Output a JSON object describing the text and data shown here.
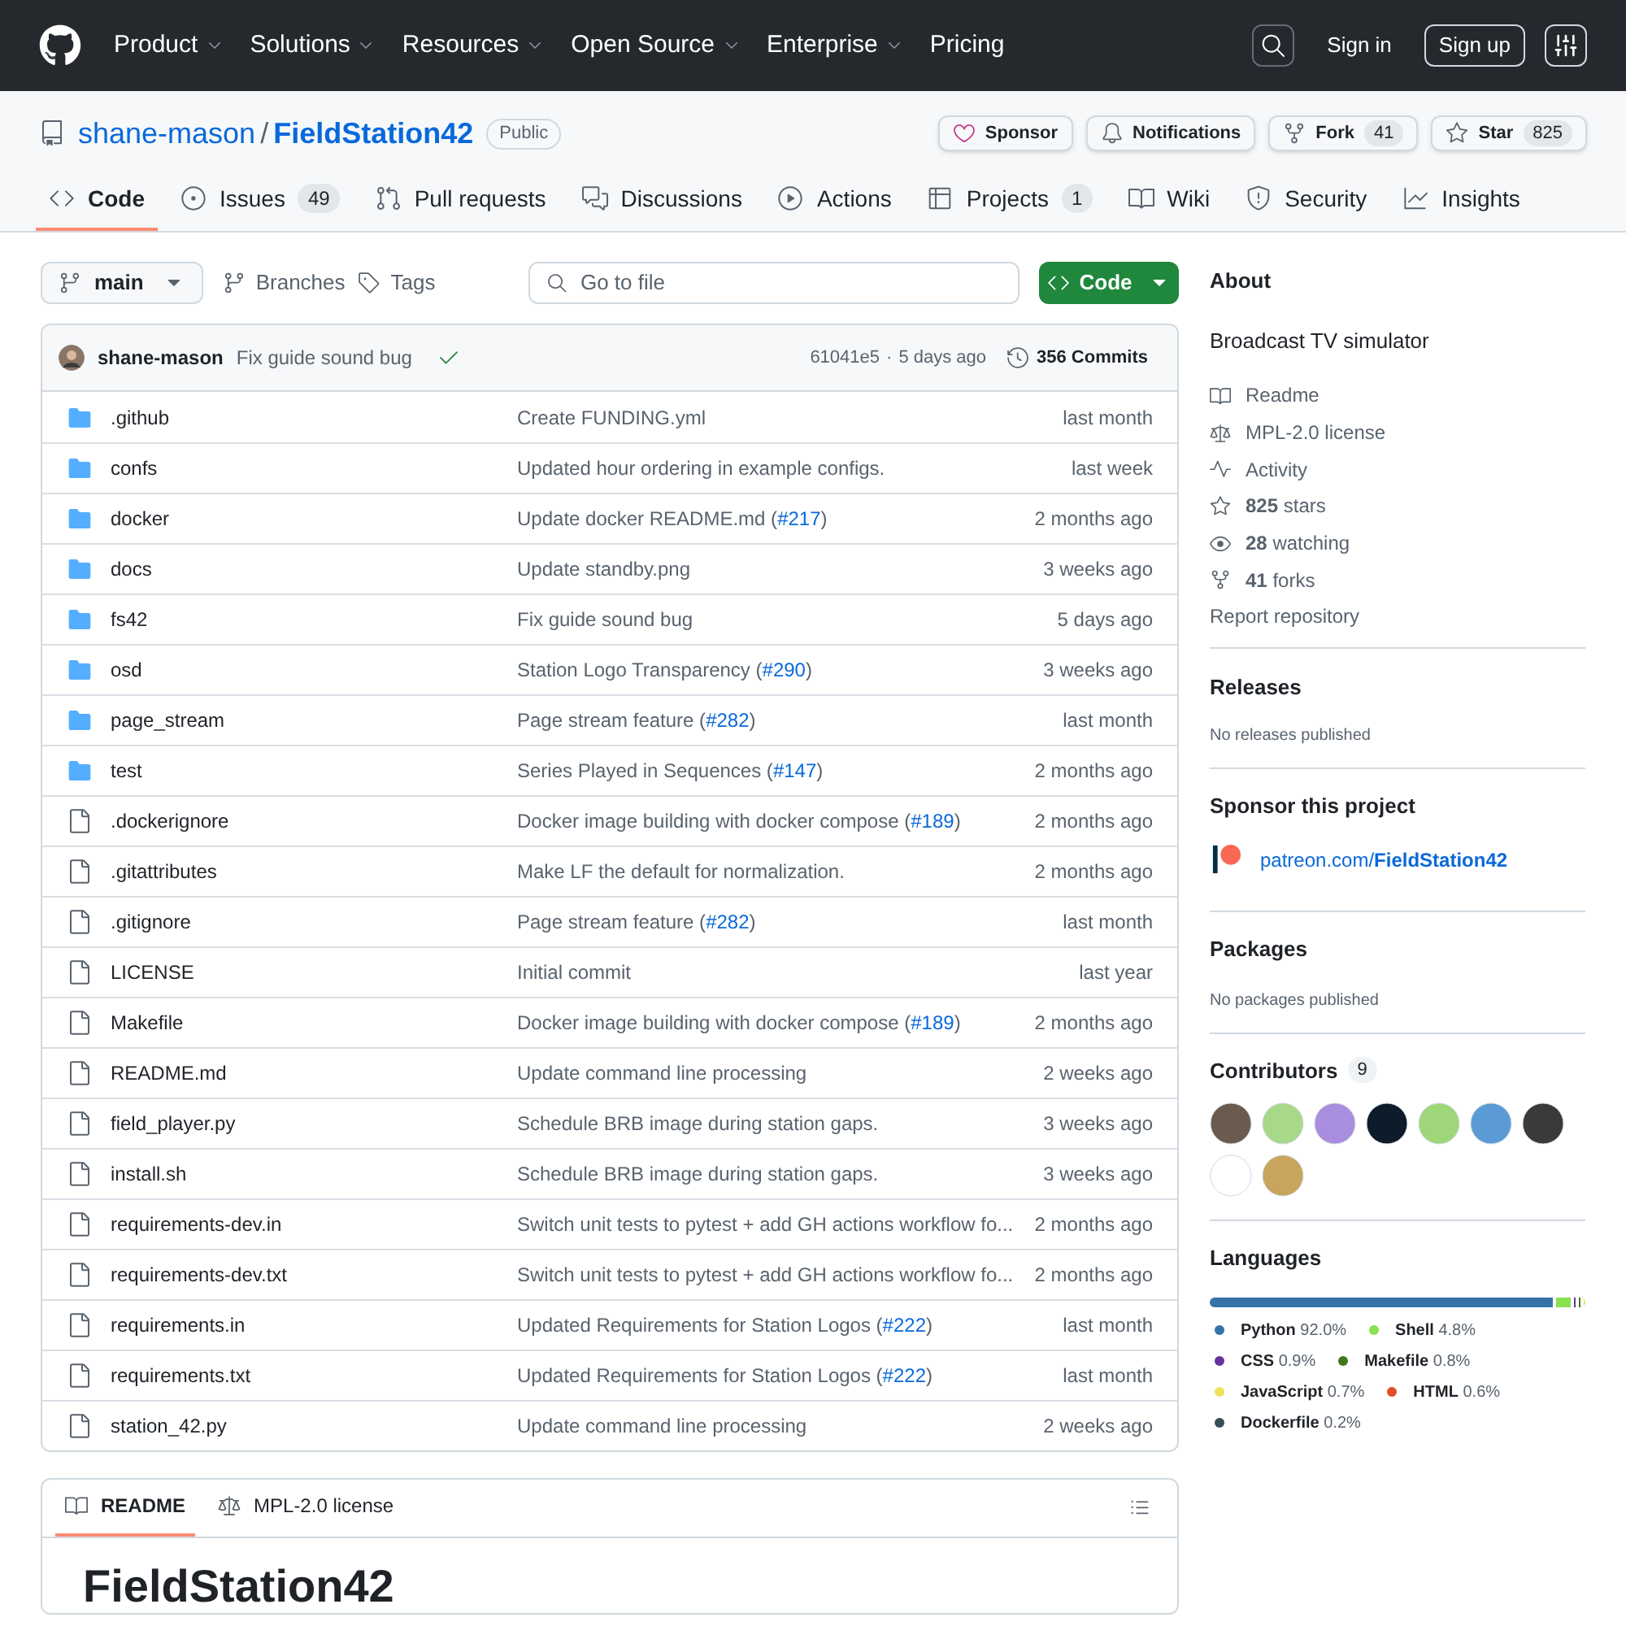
{
  "top_nav": {
    "items": [
      {
        "label": "Product",
        "dropdown": true
      },
      {
        "label": "Solutions",
        "dropdown": true
      },
      {
        "label": "Resources",
        "dropdown": true
      },
      {
        "label": "Open Source",
        "dropdown": true
      },
      {
        "label": "Enterprise",
        "dropdown": true
      },
      {
        "label": "Pricing",
        "dropdown": false
      }
    ],
    "sign_in": "Sign in",
    "sign_up": "Sign up"
  },
  "repo": {
    "owner": "shane-mason",
    "separator": "/",
    "name": "FieldStation42",
    "visibility": "Public",
    "actions": [
      {
        "kind": "sponsor",
        "label": "Sponsor"
      },
      {
        "kind": "notifications",
        "label": "Notifications"
      },
      {
        "kind": "fork",
        "label": "Fork",
        "count": "41"
      },
      {
        "kind": "star",
        "label": "Star",
        "count": "825"
      }
    ]
  },
  "tabs": [
    {
      "kind": "code",
      "label": "Code",
      "selected": true
    },
    {
      "kind": "issues",
      "label": "Issues",
      "count": "49",
      "selected": false
    },
    {
      "kind": "pulls",
      "label": "Pull requests",
      "selected": false
    },
    {
      "kind": "discussions",
      "label": "Discussions",
      "selected": false
    },
    {
      "kind": "actions",
      "label": "Actions",
      "selected": false
    },
    {
      "kind": "projects",
      "label": "Projects",
      "count": "1",
      "selected": false
    },
    {
      "kind": "wiki",
      "label": "Wiki",
      "selected": false
    },
    {
      "kind": "security",
      "label": "Security",
      "selected": false
    },
    {
      "kind": "insights",
      "label": "Insights",
      "selected": false
    }
  ],
  "toolbar": {
    "branch": "main",
    "branches": "Branches",
    "tags": "Tags",
    "search": {
      "placeholder": "Go to file"
    },
    "code_button": "Code"
  },
  "latest_commit": {
    "author": "shane-mason",
    "message": "Fix guide sound bug",
    "status_ok": true,
    "sha": "61041e5",
    "separator": "·",
    "time": "5 days ago",
    "commits": "356 Commits"
  },
  "files": [
    {
      "kind": "folder",
      "name": ".github",
      "message": "Create FUNDING.yml",
      "time": "last month"
    },
    {
      "kind": "folder",
      "name": "confs",
      "message": "Updated hour ordering in example configs.",
      "time": "last week"
    },
    {
      "kind": "folder",
      "name": "docker",
      "message": "Update docker README.md (",
      "link": "#217",
      "after": ")",
      "time": "2 months ago"
    },
    {
      "kind": "folder",
      "name": "docs",
      "message": "Update standby.png",
      "time": "3 weeks ago"
    },
    {
      "kind": "folder",
      "name": "fs42",
      "message": "Fix guide sound bug",
      "time": "5 days ago"
    },
    {
      "kind": "folder",
      "name": "osd",
      "message": "Station Logo Transparency (",
      "link": "#290",
      "after": ")",
      "time": "3 weeks ago"
    },
    {
      "kind": "folder",
      "name": "page_stream",
      "message": "Page stream feature (",
      "link": "#282",
      "after": ")",
      "time": "last month"
    },
    {
      "kind": "folder",
      "name": "test",
      "message": "Series Played in Sequences (",
      "link": "#147",
      "after": ")",
      "time": "2 months ago"
    },
    {
      "kind": "file",
      "name": ".dockerignore",
      "message": "Docker image building with docker compose (",
      "link": "#189",
      "after": ")",
      "time": "2 months ago"
    },
    {
      "kind": "file",
      "name": ".gitattributes",
      "message": "Make LF the default for normalization.",
      "time": "2 months ago"
    },
    {
      "kind": "file",
      "name": ".gitignore",
      "message": "Page stream feature (",
      "link": "#282",
      "after": ")",
      "time": "last month"
    },
    {
      "kind": "file",
      "name": "LICENSE",
      "message": "Initial commit",
      "time": "last year"
    },
    {
      "kind": "file",
      "name": "Makefile",
      "message": "Docker image building with docker compose (",
      "link": "#189",
      "after": ")",
      "time": "2 months ago"
    },
    {
      "kind": "file",
      "name": "README.md",
      "message": "Update command line processing",
      "time": "2 weeks ago"
    },
    {
      "kind": "file",
      "name": "field_player.py",
      "message": "Schedule BRB image during station gaps.",
      "time": "3 weeks ago"
    },
    {
      "kind": "file",
      "name": "install.sh",
      "message": "Schedule BRB image during station gaps.",
      "time": "3 weeks ago"
    },
    {
      "kind": "file",
      "name": "requirements-dev.in",
      "message": "Switch unit tests to pytest + add GH actions workflow fo...",
      "time": "2 months ago"
    },
    {
      "kind": "file",
      "name": "requirements-dev.txt",
      "message": "Switch unit tests to pytest + add GH actions workflow fo...",
      "time": "2 months ago"
    },
    {
      "kind": "file",
      "name": "requirements.in",
      "message": "Updated Requirements for Station Logos (",
      "link": "#222",
      "after": ")",
      "time": "last month"
    },
    {
      "kind": "file",
      "name": "requirements.txt",
      "message": "Updated Requirements for Station Logos (",
      "link": "#222",
      "after": ")",
      "time": "last month"
    },
    {
      "kind": "file",
      "name": "station_42.py",
      "message": "Update command line processing",
      "time": "2 weeks ago"
    }
  ],
  "readme": {
    "tabs": [
      {
        "kind": "readme",
        "label": "README",
        "selected": true
      },
      {
        "kind": "license",
        "label": "MPL-2.0 license",
        "selected": false
      }
    ],
    "heading": "FieldStation42"
  },
  "about": {
    "title": "About",
    "description": "Broadcast TV simulator",
    "links": [
      {
        "kind": "readme",
        "label": "Readme"
      },
      {
        "kind": "license",
        "label": "MPL-2.0 license"
      },
      {
        "kind": "activity",
        "label": "Activity"
      },
      {
        "kind": "stars",
        "count": "825",
        "label": "stars"
      },
      {
        "kind": "watching",
        "count": "28",
        "label": "watching"
      },
      {
        "kind": "forks",
        "count": "41",
        "label": "forks"
      }
    ],
    "report": "Report repository"
  },
  "releases": {
    "title": "Releases",
    "note": "No releases published"
  },
  "sponsor": {
    "title": "Sponsor this project",
    "link_prefix": "patreon.com/",
    "link_name": "FieldStation42"
  },
  "packages": {
    "title": "Packages",
    "note": "No packages published"
  },
  "contributors": {
    "title": "Contributors",
    "count": "9",
    "avatars": [
      {
        "color": "#6b5b4e"
      },
      {
        "color": "#a8d88a"
      },
      {
        "color": "#a98ee0"
      },
      {
        "color": "#0d1b2a"
      },
      {
        "color": "#9fd67a"
      },
      {
        "color": "#5b9bd5"
      },
      {
        "color": "#3a3a3a"
      },
      {
        "color": "#ffffff"
      },
      {
        "color": "#c9a45c"
      }
    ]
  },
  "languages": {
    "title": "Languages",
    "items": [
      {
        "name": "Python",
        "percent": "92.0%",
        "color": "#3572a5"
      },
      {
        "name": "Shell",
        "percent": "4.8%",
        "color": "#89e051"
      },
      {
        "name": "CSS",
        "percent": "0.9%",
        "color": "#663399"
      },
      {
        "name": "Makefile",
        "percent": "0.8%",
        "color": "#427819"
      },
      {
        "name": "JavaScript",
        "percent": "0.7%",
        "color": "#f1e05a"
      },
      {
        "name": "HTML",
        "percent": "0.6%",
        "color": "#e34c26"
      },
      {
        "name": "Dockerfile",
        "percent": "0.2%",
        "color": "#384d54"
      }
    ]
  }
}
